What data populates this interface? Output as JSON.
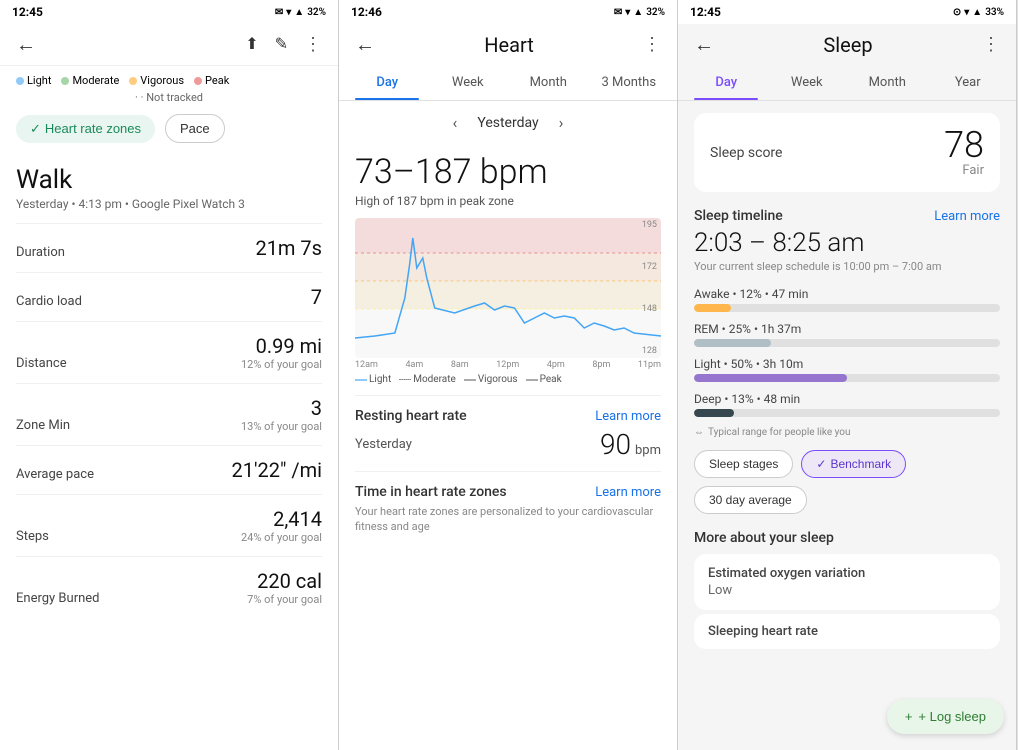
{
  "panel1": {
    "status": {
      "time": "12:45",
      "battery": "32%"
    },
    "legend": [
      {
        "label": "Light",
        "color": "#90caf9"
      },
      {
        "label": "Moderate",
        "color": "#a5d6a7"
      },
      {
        "label": "Vigorous",
        "color": "#ffcc80"
      },
      {
        "label": "Peak",
        "color": "#ef9a9a"
      }
    ],
    "not_tracked": "Not tracked",
    "buttons": {
      "heart_zones": "Heart rate zones",
      "pace": "Pace"
    },
    "activity": "Walk",
    "subtitle": "Yesterday • 4:13 pm • Google Pixel Watch 3",
    "stats": [
      {
        "label": "Duration",
        "value": "21m 7s",
        "sub": ""
      },
      {
        "label": "Cardio load",
        "value": "7",
        "sub": ""
      },
      {
        "label": "Distance",
        "value": "0.99 mi",
        "sub": "12% of your goal"
      },
      {
        "label": "Zone Min",
        "value": "3",
        "sub": "13% of your goal"
      },
      {
        "label": "Average pace",
        "value": "21'22\" /mi",
        "sub": ""
      },
      {
        "label": "Steps",
        "value": "2,414",
        "sub": "24% of your goal"
      },
      {
        "label": "Energy Burned",
        "value": "220 cal",
        "sub": "7% of your goal"
      }
    ]
  },
  "panel2": {
    "status": {
      "time": "12:46",
      "battery": "32%"
    },
    "title": "Heart",
    "tabs": [
      "Day",
      "Week",
      "Month",
      "3 Months"
    ],
    "active_tab": 0,
    "date_nav": {
      "prev": "‹",
      "label": "Yesterday",
      "next": "›"
    },
    "bpm_range": "73–187 bpm",
    "bpm_sub": "High of 187 bpm in peak zone",
    "chart_labels": [
      "195",
      "172",
      "148",
      "128"
    ],
    "x_labels": [
      "12am",
      "4am",
      "8am",
      "12pm",
      "4pm",
      "8pm",
      "11pm"
    ],
    "zone_labels": [
      "Light",
      "Moderate",
      "Vigorous",
      "Peak"
    ],
    "resting_hr": {
      "title": "Resting heart rate",
      "learn_more": "Learn more",
      "label": "Yesterday",
      "value": "90",
      "unit": "bpm"
    },
    "time_in_zones": {
      "title": "Time in heart rate zones",
      "learn_more": "Learn more",
      "note": "Your heart rate zones are personalized to your cardiovascular fitness and age"
    }
  },
  "panel3": {
    "status": {
      "time": "12:45",
      "battery": "33%"
    },
    "title": "Sleep",
    "tabs": [
      "Day",
      "Week",
      "Month",
      "Year"
    ],
    "active_tab": 0,
    "sleep_score": {
      "label": "Sleep score",
      "value": "78",
      "quality": "Fair"
    },
    "timeline": {
      "title": "Sleep timeline",
      "learn_more": "Learn more",
      "time_range": "2:03 – 8:25 am",
      "schedule": "Your current sleep schedule is 10:00 pm – 7:00 am"
    },
    "stages": [
      {
        "label": "Awake • 12% • 47 min",
        "color": "#ffb74d",
        "pct": 12
      },
      {
        "label": "REM • 25% • 1h 37m",
        "color": "#b0bec5",
        "pct": 25
      },
      {
        "label": "Light • 50% • 3h 10m",
        "color": "#9575cd",
        "pct": 50
      },
      {
        "label": "Deep • 13% • 48 min",
        "color": "#37474f",
        "pct": 13
      }
    ],
    "typical_range": "Typical range for people like you",
    "buttons": [
      {
        "label": "Sleep stages",
        "active": false
      },
      {
        "label": "Benchmark",
        "active": true
      },
      {
        "label": "30 day average",
        "active": false
      }
    ],
    "more_title": "More about your sleep",
    "details": [
      {
        "label": "Estimated oxygen variation",
        "value": "Low"
      },
      {
        "label": "Sleeping heart rate",
        "value": ""
      }
    ],
    "log_sleep": "+ Log sleep"
  }
}
